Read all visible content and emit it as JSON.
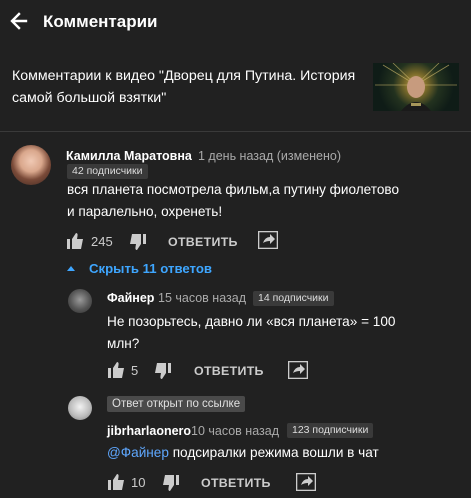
{
  "header": {
    "title": "Комментарии"
  },
  "video": {
    "caption": "Комментарии к видео \"Дворец для Путина. История самой большой взятки\""
  },
  "comment": {
    "author": "Камилла Маратовна",
    "time": "1 день назад (изменено)",
    "subscribers": "42 подписчики",
    "text": "вся планета посмотрела фильм,а путину фиолетово и паралельно, охренеть!",
    "likes": "245",
    "reply_label": "ОТВЕТИТЬ"
  },
  "hide_replies": {
    "label": "Скрыть 11 ответов"
  },
  "replies": [
    {
      "author": "Файнер",
      "time": "15 часов назад",
      "subscribers": "14 подписчики",
      "text": "Не позорьтесь, давно ли «вся планета» = 100 млн?",
      "likes": "5",
      "reply_label": "ОТВЕТИТЬ"
    },
    {
      "link_badge": "Ответ открыт по ссылке",
      "author": "jibrharlaonero",
      "time": "10 часов назад",
      "subscribers": "123 подписчики",
      "mention": "@Файнер",
      "text": " подсиралки режима вошли в чат",
      "likes": "10",
      "reply_label": "ОТВЕТИТЬ"
    }
  ],
  "icons": {
    "back": "arrow-left-icon",
    "like": "thumb-up-icon",
    "dislike": "thumb-down-icon",
    "share": "share-icon",
    "collapse": "caret-up-icon"
  },
  "colors": {
    "background": "#212121",
    "accent": "#3ea6ff",
    "mention": "#5fa8ff"
  }
}
